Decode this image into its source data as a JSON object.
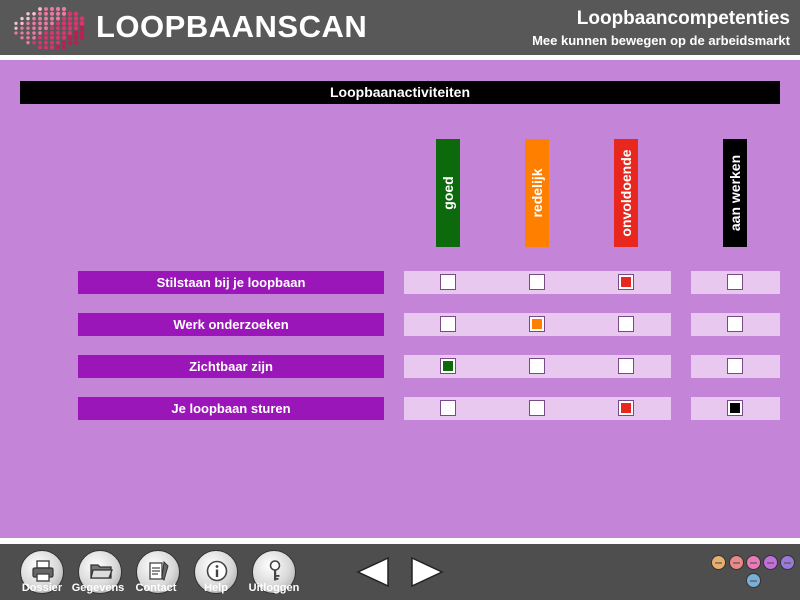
{
  "header": {
    "logo_text": "LOOPBAANSCAN",
    "title": "Loopbaancompetenties",
    "subtitle": "Mee kunnen bewegen op de arbeidsmarkt"
  },
  "section": {
    "title": "Loopbaanactiviteiten"
  },
  "columns": [
    {
      "label": "goed",
      "color": "#0c6a0c"
    },
    {
      "label": "redelijk",
      "color": "#ff7f00"
    },
    {
      "label": "onvoldoende",
      "color": "#e8281e"
    },
    {
      "label": "aan werken",
      "color": "#000000"
    }
  ],
  "rows": [
    {
      "label": "Stilstaan bij je loopbaan",
      "selected": "onvoldoende",
      "aan_werken": false
    },
    {
      "label": "Werk onderzoeken",
      "selected": "redelijk",
      "aan_werken": false
    },
    {
      "label": "Zichtbaar zijn",
      "selected": "goed",
      "aan_werken": false
    },
    {
      "label": "Je loopbaan sturen",
      "selected": "onvoldoende",
      "aan_werken": true
    }
  ],
  "footer": {
    "buttons": [
      {
        "label": "Dossier",
        "icon": "printer-icon"
      },
      {
        "label": "Gegevens",
        "icon": "folder-icon"
      },
      {
        "label": "Contact",
        "icon": "contact-icon"
      },
      {
        "label": "Help",
        "icon": "info-icon"
      },
      {
        "label": "Uitloggen",
        "icon": "key-icon"
      }
    ],
    "arrows": {
      "prev": "arrow-left-icon",
      "next": "arrow-right-icon"
    },
    "progress_dots": [
      "#e8b070",
      "#e88a8a",
      "#e87ab8",
      "#c070d8",
      "#9a7ad8",
      "#7ab0d8"
    ]
  }
}
